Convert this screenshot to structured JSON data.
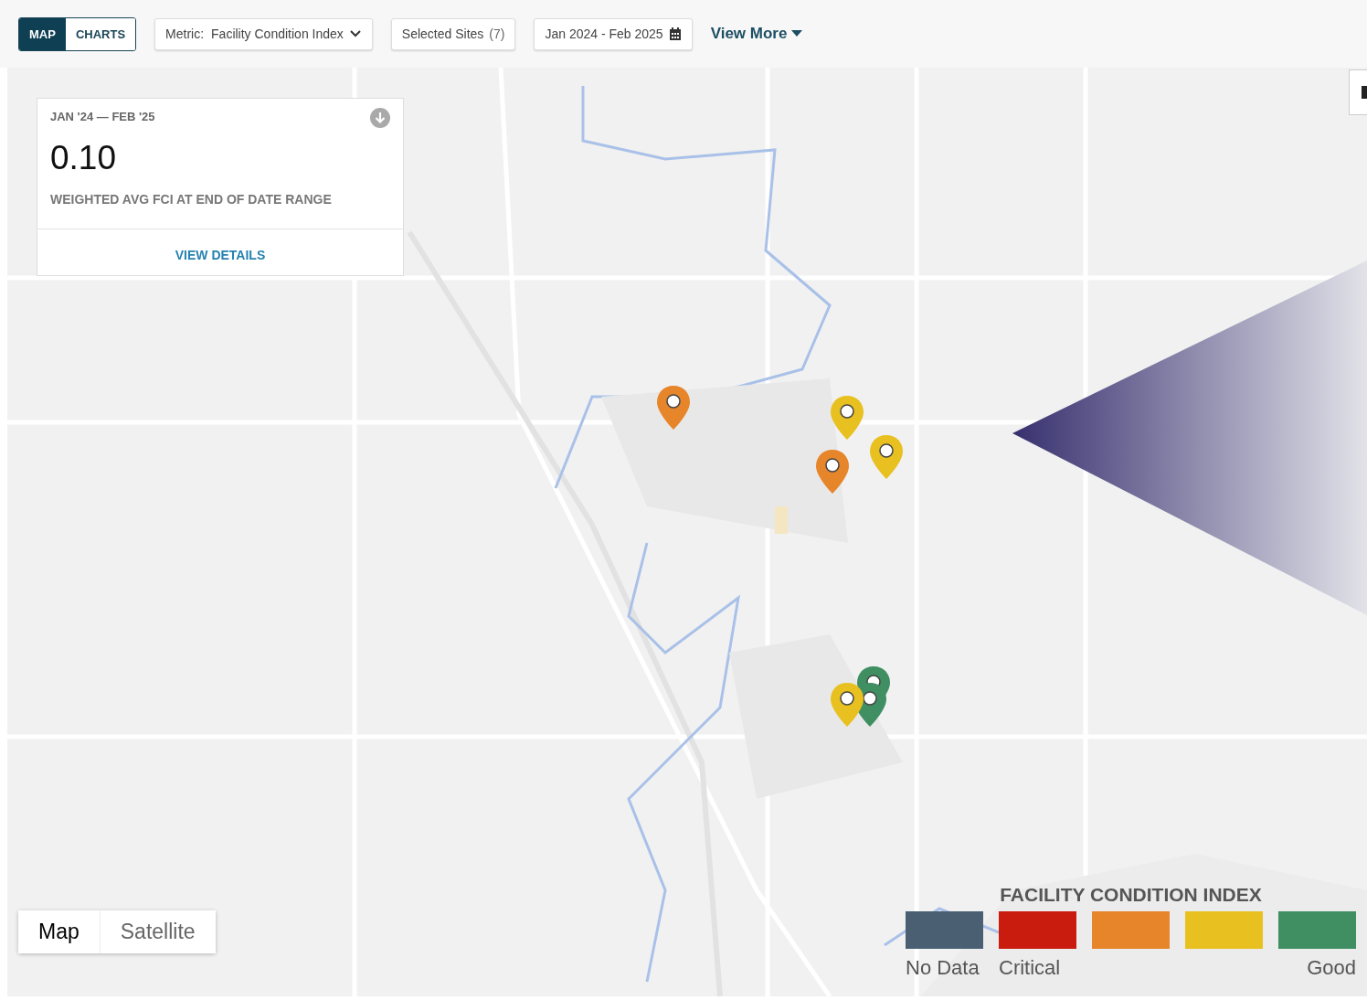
{
  "view_toggle": [
    {
      "label": "MAP",
      "selected": true
    },
    {
      "label": "CHARTS",
      "selected": false
    }
  ],
  "toolbar": {
    "metric": {
      "label": "Metric:",
      "value": "Facility Condition Index"
    },
    "selected_sites": {
      "label": "Selected Sites",
      "count": "(7)"
    },
    "date_range": "Jan 2024 - Feb 2025",
    "view_more": "View More"
  },
  "summary_card": {
    "period": "JAN '24 — FEB '25",
    "value": "0.10",
    "caption": "WEIGHTED AVG FCI AT END OF DATE RANGE",
    "link": "VIEW DETAILS"
  },
  "map": {
    "kind": "picture",
    "pins": [
      {
        "color": "#e6852a"
      },
      {
        "color": "#e8c020"
      },
      {
        "color": "#e8c020"
      },
      {
        "color": "#e6852a"
      },
      {
        "color": "#3f8f63"
      },
      {
        "color": "#3f8f63"
      },
      {
        "color": "#e8c020"
      }
    ],
    "map_type": [
      {
        "label": "Map",
        "selected": true
      },
      {
        "label": "Satellite",
        "selected": false
      }
    ]
  },
  "legend": {
    "title": "FACILITY CONDITION INDEX",
    "items": [
      {
        "color": "#4a6072",
        "label": "No Data"
      },
      {
        "color": "#c91c0e",
        "label": "Critical"
      },
      {
        "color": "#e6852a"
      },
      {
        "color": "#e8c020"
      },
      {
        "color": "#3f8f63",
        "label": "Good"
      }
    ]
  }
}
